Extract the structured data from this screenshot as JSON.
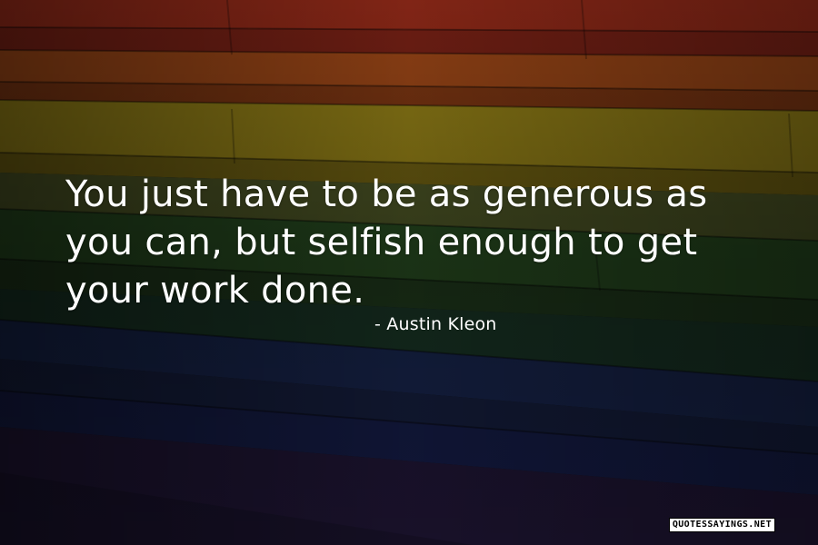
{
  "quote": {
    "text": "You just have to be as generous as you can, but selfish enough to get your work done.",
    "author": "- Austin Kleon"
  },
  "watermark": {
    "text": "QUOTESSAYINGS.NET"
  },
  "colors": {
    "text": "#ffffff",
    "step_red": "#b8361f",
    "step_orange": "#c2561c",
    "step_yellow": "#b9a11c",
    "step_green": "#2f5a26",
    "step_blue": "#1d2a5a",
    "step_purple": "#2a1c45"
  }
}
